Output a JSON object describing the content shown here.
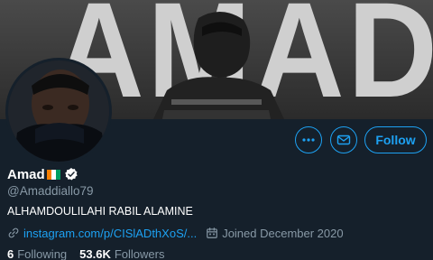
{
  "banner": {
    "text": "AMAD"
  },
  "actions": {
    "more_icon": "more-dots-icon",
    "message_icon": "envelope-icon",
    "follow_label": "Follow",
    "accent": "#1da1f2"
  },
  "profile": {
    "display_name": "Amad",
    "flag_icon": "ivory-coast-flag-icon",
    "verified_icon": "verified-badge-icon",
    "handle": "@Amaddiallo79",
    "bio": "ALHAMDOULILAHI RABIL ALAMINE",
    "link": "instagram.com/p/CISlADthXoS/...",
    "joined": "Joined December 2020"
  },
  "stats": {
    "following_count": "6",
    "following_label": "Following",
    "followers_count": "53.6K",
    "followers_label": "Followers"
  }
}
